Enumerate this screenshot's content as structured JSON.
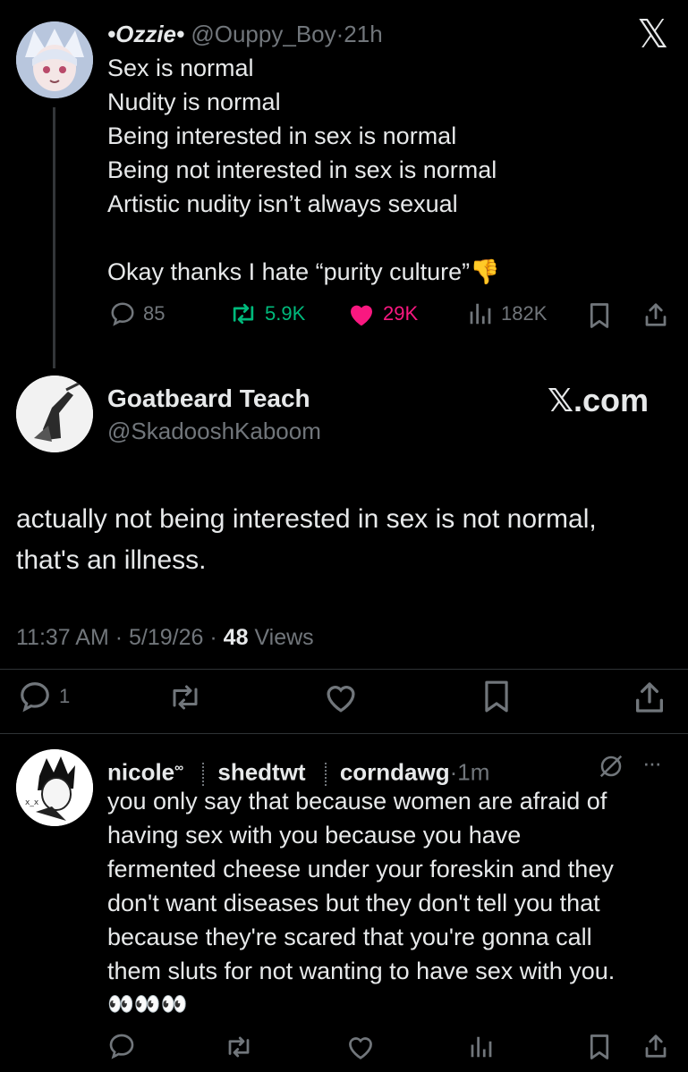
{
  "tweet1": {
    "display_name": "•Ozzie•",
    "handle": "@Ouppy_Boy",
    "sep": "·",
    "time": "21h",
    "lines": [
      "Sex is normal",
      "Nudity is normal",
      "Being interested in sex is normal",
      "Being not interested in sex is normal",
      "Artistic nudity isn’t always sexual",
      "",
      "Okay thanks I hate “purity culture”👎"
    ],
    "stats": {
      "replies": "85",
      "reposts": "5.9K",
      "likes": "29K",
      "views": "182K"
    }
  },
  "x_logo": "𝕏",
  "tweet2": {
    "display_name": "Goatbeard Teach",
    "handle": "@SkadooshKaboom",
    "brand": "𝕏.com",
    "text_lines": [
      "actually not being interested in sex is not normal,",
      "that's an illness."
    ],
    "time": "11:37 AM",
    "date": "5/19/26",
    "sep": "·",
    "views_count": "48",
    "views_label": "Views",
    "replies": "1"
  },
  "tweet3": {
    "name_part1": "nicole",
    "name_sup": "∞",
    "name_part2": "shedtwt",
    "name_part3": "corndawg",
    "sep": "·",
    "time": "1m",
    "more": "···",
    "lines": [
      "you only say that because women are afraid of",
      "having sex with you because you have",
      "fermented cheese under your foreskin and they",
      "don't want diseases but they don't tell you that",
      "because they're scared that you're gonna call",
      "them sluts for not wanting to have sex with you."
    ],
    "emoji_line": "👀👀👀"
  },
  "colors": {
    "background": "#000000",
    "text": "#e7e9ea",
    "muted": "#71767b",
    "like": "#f91880",
    "repost": "#00ba7c"
  }
}
